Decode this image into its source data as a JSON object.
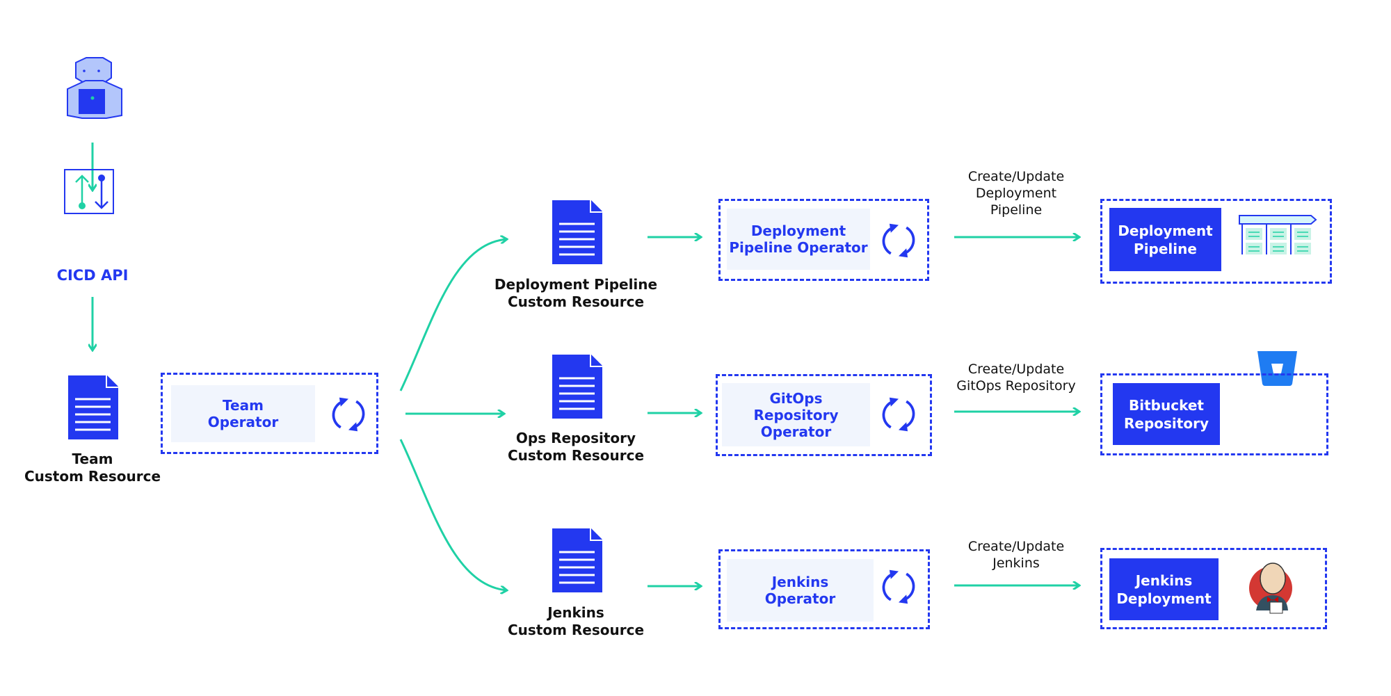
{
  "colors": {
    "primary": "#2338f0",
    "accent": "#1fd1a5",
    "panel": "#f1f5fd"
  },
  "user": {
    "icon": "developer-user-icon"
  },
  "cicd_api": {
    "label": "CICD API",
    "icon": "api-arrows-icon"
  },
  "team_cr": {
    "label": "Team\nCustom Resource",
    "icon": "document-icon"
  },
  "team_operator": {
    "label": "Team\nOperator",
    "icon": "sync-icon"
  },
  "resources": [
    {
      "label": "Deployment Pipeline\nCustom Resource",
      "operator": "Deployment\nPipeline Operator",
      "action": "Create/Update\nDeployment\nPipeline",
      "target": "Deployment\nPipeline",
      "target_icon": "pipeline-icon"
    },
    {
      "label": "Ops Repository\nCustom Resource",
      "operator": "GitOps\nRepository\nOperator",
      "action": "Create/Update\nGitOps Repository",
      "target": "Bitbucket\nRepository",
      "target_icon": "bitbucket-logo-icon"
    },
    {
      "label": "Jenkins\nCustom Resource",
      "operator": "Jenkins\nOperator",
      "action": "Create/Update\nJenkins",
      "target": "Jenkins\nDeployment",
      "target_icon": "jenkins-logo-icon"
    }
  ]
}
